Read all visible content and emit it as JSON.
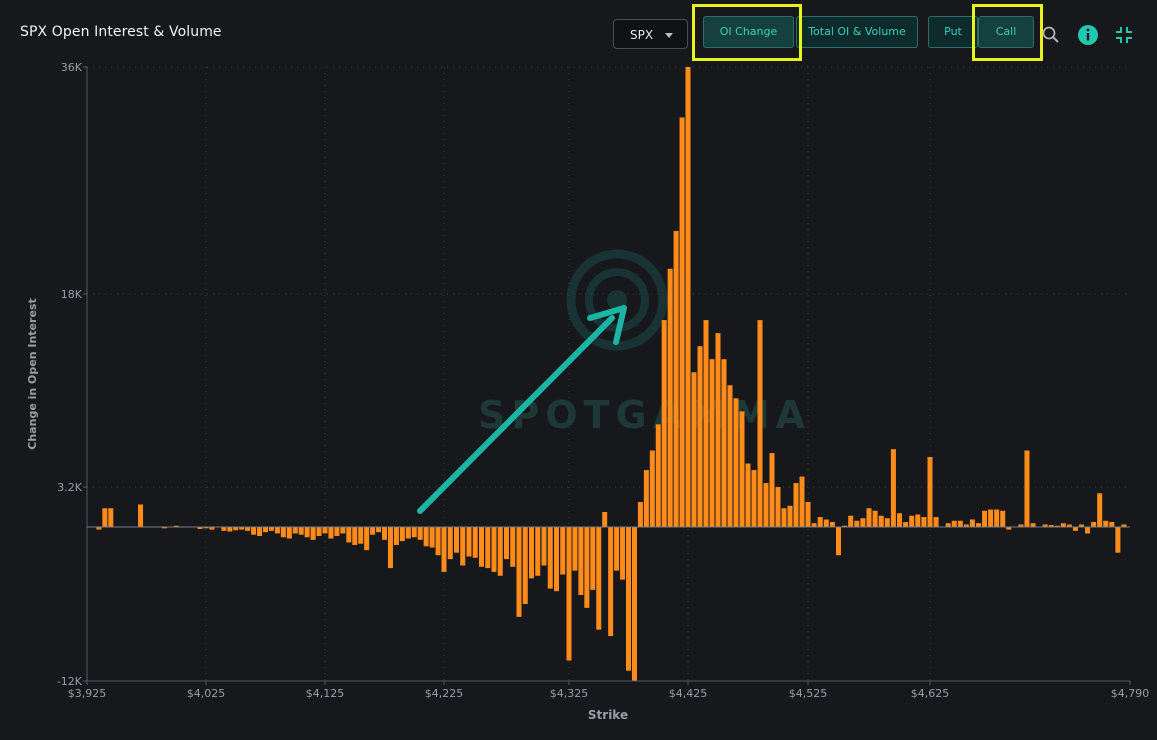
{
  "header": {
    "title": "SPX Open Interest & Volume",
    "ticker": "SPX",
    "buttons": {
      "oi_change": "OI Change",
      "total_oi_volume": "Total OI & Volume",
      "put": "Put",
      "call": "Call"
    }
  },
  "icons": {
    "search": "search-icon",
    "info": "info-icon",
    "collapse": "collapse-icon"
  },
  "colors": {
    "bars": "#ff8c1a",
    "accent": "#35d3bf",
    "highlight": "#e7f31a",
    "arrow": "#1bb5a3",
    "background": "#16181c"
  },
  "watermark": "SPOTGAMMA",
  "chart_data": {
    "type": "bar",
    "xlabel": "Strike",
    "ylabel": "Change in Open Interest",
    "y_ticks": [
      "36K",
      "18K",
      "3.2K",
      "-12K"
    ],
    "x_ticks": [
      "$3,925",
      "$4,025",
      "$4,125",
      "$4,225",
      "$4,325",
      "$4,425",
      "$4,525",
      "$4,625",
      "$4,790"
    ],
    "ylim": [
      -12000,
      36000
    ],
    "xlim": [
      3925,
      4790
    ],
    "grid": true,
    "series": [
      {
        "values": [
          [
            3935,
            -200
          ],
          [
            3940,
            1500
          ],
          [
            3945,
            1500
          ],
          [
            3970,
            1800
          ],
          [
            3990,
            -100
          ],
          [
            4000,
            100
          ],
          [
            4020,
            -150
          ],
          [
            4025,
            -100
          ],
          [
            4030,
            -200
          ],
          [
            4040,
            -300
          ],
          [
            4045,
            -350
          ],
          [
            4050,
            -250
          ],
          [
            4055,
            -200
          ],
          [
            4060,
            -300
          ],
          [
            4065,
            -600
          ],
          [
            4070,
            -700
          ],
          [
            4075,
            -400
          ],
          [
            4080,
            -300
          ],
          [
            4085,
            -500
          ],
          [
            4090,
            -800
          ],
          [
            4095,
            -900
          ],
          [
            4100,
            -500
          ],
          [
            4105,
            -600
          ],
          [
            4110,
            -800
          ],
          [
            4115,
            -1000
          ],
          [
            4120,
            -700
          ],
          [
            4125,
            -500
          ],
          [
            4130,
            -900
          ],
          [
            4135,
            -700
          ],
          [
            4140,
            -500
          ],
          [
            4145,
            -1200
          ],
          [
            4150,
            -1400
          ],
          [
            4155,
            -1300
          ],
          [
            4160,
            -1800
          ],
          [
            4165,
            -600
          ],
          [
            4170,
            -400
          ],
          [
            4175,
            -1000
          ],
          [
            4180,
            -3200
          ],
          [
            4185,
            -1400
          ],
          [
            4190,
            -1100
          ],
          [
            4195,
            -900
          ],
          [
            4200,
            -800
          ],
          [
            4205,
            -1000
          ],
          [
            4210,
            -1500
          ],
          [
            4215,
            -1600
          ],
          [
            4220,
            -2200
          ],
          [
            4225,
            -3500
          ],
          [
            4230,
            -2500
          ],
          [
            4235,
            -2000
          ],
          [
            4240,
            -3000
          ],
          [
            4245,
            -2300
          ],
          [
            4250,
            -2400
          ],
          [
            4255,
            -3100
          ],
          [
            4260,
            -3200
          ],
          [
            4265,
            -3500
          ],
          [
            4270,
            -3800
          ],
          [
            4275,
            -2500
          ],
          [
            4280,
            -3100
          ],
          [
            4285,
            -7000
          ],
          [
            4290,
            -6000
          ],
          [
            4295,
            -4000
          ],
          [
            4300,
            -3800
          ],
          [
            4305,
            -3000
          ],
          [
            4310,
            -4800
          ],
          [
            4315,
            -5000
          ],
          [
            4320,
            -3700
          ],
          [
            4325,
            -10400
          ],
          [
            4330,
            -3400
          ],
          [
            4335,
            -5300
          ],
          [
            4340,
            -6300
          ],
          [
            4345,
            -4900
          ],
          [
            4350,
            -8000
          ],
          [
            4355,
            1200
          ],
          [
            4360,
            -8500
          ],
          [
            4365,
            -3400
          ],
          [
            4370,
            -4100
          ],
          [
            4375,
            -11200
          ],
          [
            4380,
            -12000
          ],
          [
            4385,
            2000
          ],
          [
            4390,
            4500
          ],
          [
            4395,
            6000
          ],
          [
            4400,
            8000
          ],
          [
            4405,
            16000
          ],
          [
            4410,
            20000
          ],
          [
            4415,
            23000
          ],
          [
            4420,
            32000
          ],
          [
            4425,
            36000
          ],
          [
            4430,
            12000
          ],
          [
            4435,
            14000
          ],
          [
            4440,
            16000
          ],
          [
            4445,
            13000
          ],
          [
            4450,
            15000
          ],
          [
            4455,
            13000
          ],
          [
            4460,
            11000
          ],
          [
            4465,
            10000
          ],
          [
            4470,
            9000
          ],
          [
            4475,
            5000
          ],
          [
            4480,
            4500
          ],
          [
            4485,
            16000
          ],
          [
            4490,
            3500
          ],
          [
            4495,
            5800
          ],
          [
            4500,
            3200
          ],
          [
            4505,
            1500
          ],
          [
            4510,
            1700
          ],
          [
            4515,
            3500
          ],
          [
            4520,
            4000
          ],
          [
            4525,
            2000
          ],
          [
            4530,
            300
          ],
          [
            4535,
            800
          ],
          [
            4540,
            600
          ],
          [
            4545,
            400
          ],
          [
            4550,
            -2200
          ],
          [
            4555,
            100
          ],
          [
            4560,
            900
          ],
          [
            4565,
            500
          ],
          [
            4570,
            700
          ],
          [
            4575,
            1500
          ],
          [
            4580,
            1300
          ],
          [
            4585,
            900
          ],
          [
            4590,
            700
          ],
          [
            4595,
            6100
          ],
          [
            4600,
            1100
          ],
          [
            4605,
            400
          ],
          [
            4610,
            900
          ],
          [
            4615,
            1000
          ],
          [
            4620,
            800
          ],
          [
            4625,
            5500
          ],
          [
            4630,
            800
          ],
          [
            4640,
            300
          ],
          [
            4645,
            500
          ],
          [
            4650,
            500
          ],
          [
            4655,
            200
          ],
          [
            4660,
            600
          ],
          [
            4665,
            300
          ],
          [
            4670,
            1300
          ],
          [
            4675,
            1400
          ],
          [
            4680,
            1400
          ],
          [
            4685,
            1300
          ],
          [
            4690,
            -200
          ],
          [
            4700,
            200
          ],
          [
            4705,
            6000
          ],
          [
            4710,
            300
          ],
          [
            4720,
            200
          ],
          [
            4725,
            150
          ],
          [
            4730,
            100
          ],
          [
            4735,
            300
          ],
          [
            4740,
            200
          ],
          [
            4745,
            -300
          ],
          [
            4750,
            200
          ],
          [
            4755,
            -500
          ],
          [
            4760,
            400
          ],
          [
            4765,
            2700
          ],
          [
            4770,
            500
          ],
          [
            4775,
            400
          ],
          [
            4780,
            -2000
          ],
          [
            4785,
            200
          ]
        ]
      }
    ]
  }
}
